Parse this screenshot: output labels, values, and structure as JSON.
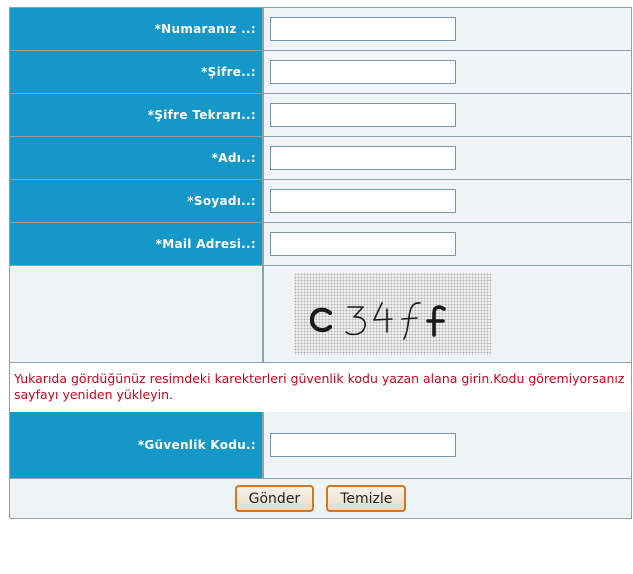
{
  "form": {
    "fields": [
      {
        "label": "*Numaranız ..:",
        "value": ""
      },
      {
        "label": "*Şifre..:",
        "value": ""
      },
      {
        "label": "*Şifre Tekrarı..:",
        "value": ""
      },
      {
        "label": "*Adı..:",
        "value": ""
      },
      {
        "label": "*Soyadı..:",
        "value": ""
      },
      {
        "label": "*Mail Adresi..:",
        "value": ""
      }
    ],
    "captcha": {
      "text": "c34ff"
    },
    "note": "Yukarıda gördüğünüz resimdeki karekterleri güvenlik kodu yazan alana girin.Kodu göremiyorsanız sayfayı yeniden yükleyin.",
    "security_code": {
      "label": "*Güvenlik Kodu.:",
      "value": ""
    },
    "buttons": {
      "submit": "Gönder",
      "reset": "Temizle"
    }
  },
  "colors": {
    "label_bg": "#1597c7",
    "field_bg": "#eef4f5",
    "note_text": "#d0021b",
    "button_border": "#d9751c"
  }
}
